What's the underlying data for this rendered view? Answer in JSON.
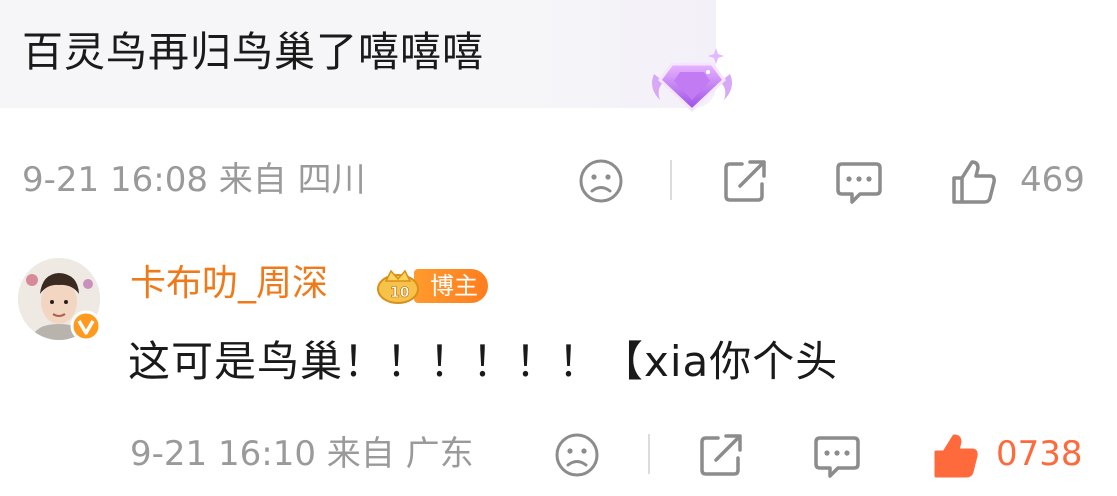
{
  "top_comment": {
    "text": "百灵鸟再归鸟巢了嘻嘻嘻",
    "badge_icon": "diamond-gem-icon",
    "meta": "9-21 16:08 来自 四川",
    "like_count": "469"
  },
  "reply": {
    "username": "卡布叻_周深",
    "badge_label": "博主",
    "text": "这可是鸟巢！！！！！！【xia你个头",
    "meta": "9-21 16:10 来自 广东",
    "like_count": "0738"
  },
  "colors": {
    "username": "#f07a1a",
    "meta": "#9a9a9a",
    "bubble_bg": "#f6f6f8",
    "like_active": "#ff6a3d"
  },
  "icons": [
    "sad-face-icon",
    "share-icon",
    "comment-icon",
    "thumbs-up-icon",
    "verified-v-icon",
    "crown-badge-icon"
  ]
}
